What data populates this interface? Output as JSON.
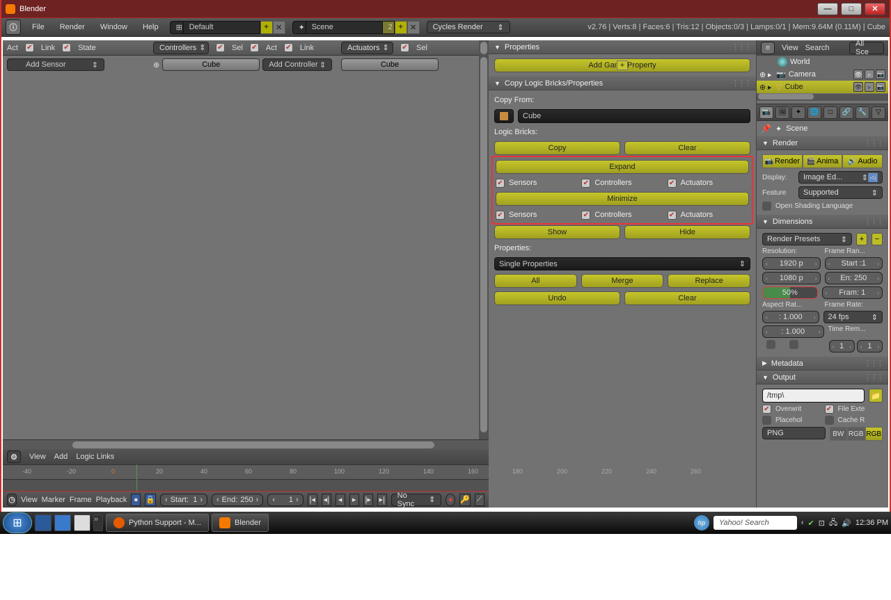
{
  "window": {
    "title": "Blender"
  },
  "menubar": {
    "items": [
      "File",
      "Render",
      "Window",
      "Help"
    ],
    "layout": "Default",
    "scene": "Scene",
    "scene_users": "2",
    "engine": "Cycles Render",
    "stats": "v2.76 | Verts:8 | Faces:6 | Tris:12 | Objects:0/3 | Lamps:0/1 | Mem:9.64M (0.11M) | Cube"
  },
  "logic": {
    "header1": {
      "act": "Act",
      "link": "Link",
      "state": "State"
    },
    "controllers_label": "Controllers",
    "sel": "Sel",
    "header2": {
      "act": "Act",
      "link": "Link"
    },
    "actuators_label": "Actuators",
    "add_sensor": "Add Sensor",
    "cube": "Cube",
    "add_controller": "Add Controller",
    "footer": {
      "view": "View",
      "add": "Add",
      "logic_links": "Logic Links"
    }
  },
  "properties_panel": {
    "title": "Properties",
    "add_game_property": "Add Game Property",
    "copy_panel": {
      "title": "Copy Logic Bricks/Properties",
      "copy_from": "Copy From:",
      "object": "Cube",
      "logic_bricks": "Logic Bricks:",
      "copy": "Copy",
      "clear": "Clear",
      "expand": "Expand",
      "minimize": "Minimize",
      "sensors": "Sensors",
      "controllers": "Controllers",
      "actuators": "Actuators",
      "show": "Show",
      "hide": "Hide",
      "properties": "Properties:",
      "mode": "Single Properties",
      "all": "All",
      "merge": "Merge",
      "replace": "Replace",
      "undo": "Undo",
      "clear2": "Clear"
    }
  },
  "outliner": {
    "view": "View",
    "search": "Search",
    "all": "All Sce",
    "items": [
      {
        "name": "World",
        "icon": "globe"
      },
      {
        "name": "Camera",
        "icon": "camera"
      },
      {
        "name": "Cube",
        "icon": "mesh",
        "selected": true
      }
    ]
  },
  "props_right": {
    "scene": "Scene",
    "render": {
      "title": "Render",
      "render_btn": "Render",
      "anim_btn": "Anima",
      "audio_btn": "Audio",
      "display": "Display:",
      "display_val": "Image Ed...",
      "feature": "Feature",
      "feature_val": "Supported",
      "osl": "Open Shading Language"
    },
    "dimensions": {
      "title": "Dimensions",
      "presets": "Render Presets",
      "resolution": "Resolution:",
      "frame_range": "Frame Ran...",
      "res_x": "1920 p",
      "res_y": "1080 p",
      "pct": "50%",
      "start": "Start :1",
      "end": "En: 250",
      "frame": "Fram: 1",
      "aspect": "Aspect Rat...",
      "fps_label": "Frame Rate:",
      "ax": ": 1.000",
      "ay": ": 1.000",
      "fps": "24 fps",
      "time_remap": "Time Rem...",
      "one_a": "1",
      "one_b": "1"
    },
    "metadata": "Metadata",
    "output": {
      "title": "Output",
      "path": "/tmp\\",
      "overwrite": "Overwrit",
      "file_ext": "File Exte",
      "placeholder": "Placehol",
      "cache": "Cache R",
      "png": "PNG",
      "bw": "BW",
      "rgb": "RGB",
      "rgba": "RGB"
    }
  },
  "timeline": {
    "view": "View",
    "marker": "Marker",
    "frame": "Frame",
    "playback": "Playback",
    "start_lbl": "Start:",
    "start_val": "1",
    "end_lbl": "End:",
    "end_val": "250",
    "cur": "1",
    "sync": "No Sync",
    "ticks": [
      "-40",
      "-20",
      "0",
      "20",
      "40",
      "60",
      "80",
      "100",
      "120",
      "140",
      "160",
      "180",
      "200",
      "220",
      "240",
      "260"
    ]
  },
  "taskbar": {
    "app1": "Python Support - M...",
    "app2": "Blender",
    "search": "Yahoo! Search",
    "time": "12:36 PM"
  }
}
